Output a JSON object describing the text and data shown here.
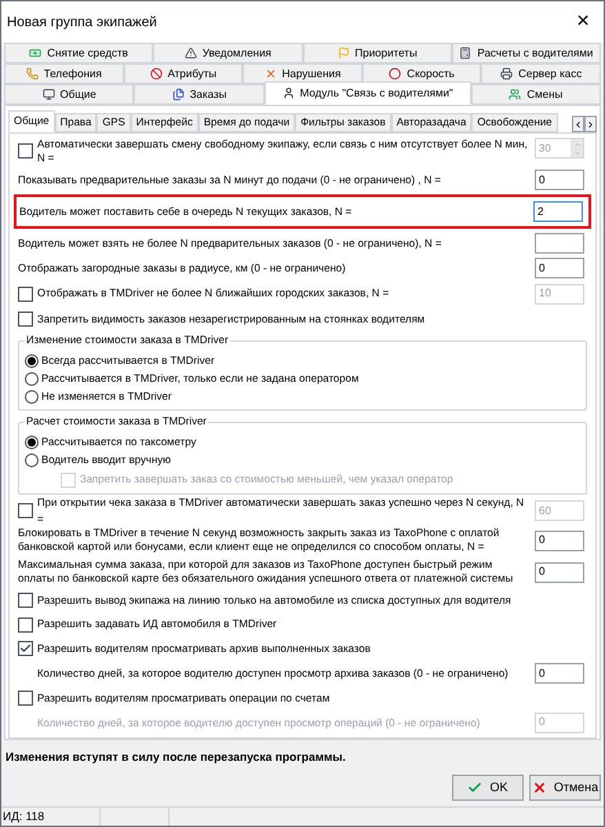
{
  "window": {
    "title": "Новая группа экипажей",
    "close": "×"
  },
  "top_tabs": [
    [
      {
        "label": "Снятие средств",
        "selected": false
      },
      {
        "label": "Уведомления",
        "selected": false
      },
      {
        "label": "Приоритеты",
        "selected": false
      },
      {
        "label": "Расчеты с водителями",
        "selected": false
      }
    ],
    [
      {
        "label": "Телефония",
        "selected": false
      },
      {
        "label": "Атрибуты",
        "selected": false
      },
      {
        "label": "Нарушения",
        "selected": false
      },
      {
        "label": "Скорость",
        "selected": false
      },
      {
        "label": "Сервер касс",
        "selected": false
      }
    ],
    [
      {
        "label": "Общие",
        "selected": false
      },
      {
        "label": "Заказы",
        "selected": false
      },
      {
        "label": "Модуль \"Связь с водителями\"",
        "selected": true
      },
      {
        "label": "Смены",
        "selected": false
      }
    ]
  ],
  "sub_tabs": [
    {
      "label": "Общие",
      "selected": true
    },
    {
      "label": "Права",
      "selected": false
    },
    {
      "label": "GPS",
      "selected": false
    },
    {
      "label": "Интерфейс",
      "selected": false
    },
    {
      "label": "Время до подачи",
      "selected": false
    },
    {
      "label": "Фильтры заказов",
      "selected": false
    },
    {
      "label": "Авторазадача",
      "selected": false
    },
    {
      "label": "Освобождение",
      "selected": false
    }
  ],
  "settings": [
    {
      "kind": "check_spin",
      "checked": false,
      "label": "Автоматически завершать смену свободному экипажу, если связь с ним отсутствует более N мин, N =",
      "value": "30",
      "disabled": true
    },
    {
      "kind": "input",
      "label": "Показывать предварительные заказы за N минут до подачи (0 - не ограничено) , N =",
      "value": "0",
      "highlighted": false
    },
    {
      "kind": "input",
      "label": "Водитель может поставить себе в очередь N текущих заказов, N =",
      "value": "2",
      "highlighted": true
    },
    {
      "kind": "input",
      "label": "Водитель может взять не более N предварительных заказов (0 - не ограничено), N =",
      "highlighted": false
    },
    {
      "kind": "input",
      "label": "Отображать загородные заказы в радиусе, км (0 - не ограничено)",
      "value": "0",
      "highlighted": false
    },
    {
      "kind": "check_input",
      "checked": false,
      "label": "Отображать в TMDriver не более N ближайших городских заказов, N =",
      "value": "10",
      "disabled": true
    },
    {
      "kind": "check",
      "checked": false,
      "label": "Запретить видимость заказов незарегистрированным на стоянках водителям"
    },
    {
      "kind": "group",
      "title": "Изменение стоимости заказа в TMDriver",
      "options": [
        {
          "label": "Всегда рассчитывается в TMDriver",
          "selected": true
        },
        {
          "label": "Рассчитывается в TMDriver, только если не задана оператором",
          "selected": false
        },
        {
          "label": "Не изменяется в TMDriver",
          "selected": false
        }
      ]
    },
    {
      "kind": "group",
      "title": "Расчет стоимости заказа в TMDriver",
      "options": [
        {
          "label": "Рассчитывается по таксометру",
          "selected": true
        },
        {
          "label": "Водитель вводит вручную",
          "selected": false
        }
      ],
      "sub_check": {
        "label": "Запретить завершать заказ со стоимостью меньшей, чем указал оператор",
        "checked": false,
        "disabled": true
      }
    },
    {
      "kind": "check_input",
      "checked": false,
      "label": "При открытии чека заказа в TMDriver автоматически завершать заказ успешно через N секунд, N =",
      "value": "60",
      "disabled": true
    },
    {
      "kind": "input",
      "label": "Блокировать в TMDriver в течение N секунд возможность закрыть заказ из TaxoPhone с оплатой банковской картой или бонусами, если клиент еще не определился со способом оплаты, N =",
      "value": "0",
      "highlighted": false
    },
    {
      "kind": "input",
      "label": "Максимальная сумма заказа, при которой для заказов из TaxoPhone доступен быстрый режим оплаты по банковской карте без обязательного ожидания успешного ответа от платежной системы",
      "value": "0",
      "highlighted": false
    },
    {
      "kind": "check",
      "checked": false,
      "label": "Разрешить вывод экипажа на линию только на автомобиле из списка доступных для водителя"
    },
    {
      "kind": "check",
      "checked": false,
      "label": "Разрешить задавать ИД автомобиля в TMDriver"
    },
    {
      "kind": "check",
      "checked": true,
      "label": "Разрешить водителям просматривать архив выполненных заказов"
    },
    {
      "kind": "sub_input",
      "label": "Количество дней, за которое водителю доступен просмотр архива заказов (0 - не ограничено)",
      "value": "0",
      "disabled": false
    },
    {
      "kind": "check",
      "checked": false,
      "label": "Разрешить водителям просматривать операции по счетам"
    },
    {
      "kind": "sub_input",
      "label": "Количество дней, за которое водителю доступен просмотр операций (0 - не ограничено)",
      "value": "0",
      "disabled": true
    }
  ],
  "note": "Изменения вступят в силу после перезапуска программы.",
  "buttons": [
    {
      "kind": "ok",
      "label": "OK"
    },
    {
      "kind": "cancel",
      "label": "Отмена"
    }
  ],
  "status_bar": {
    "id": "ИД: 118"
  }
}
